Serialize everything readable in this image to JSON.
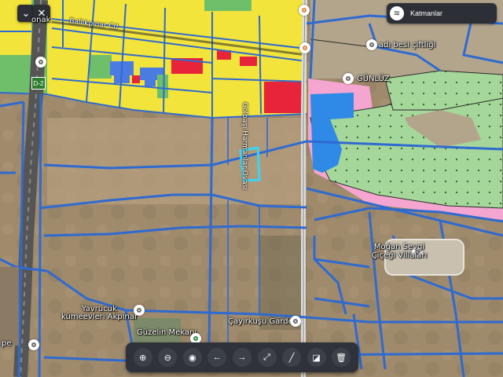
{
  "top_controls": {
    "collapse_glyph": "⌄",
    "close_glyph": "✕"
  },
  "layers": {
    "label": "Katmanlar",
    "icon": "layers-icon"
  },
  "place_labels": {
    "onak": "onak",
    "balikpinar": "Ballıkpınar Cd",
    "besi": "adı besi çiftliği",
    "gunluz": "GÜNLÜZ",
    "harmanlar": "Gölbaşı Harmanlar Ovası",
    "mogan": "Moğan Sevgi Çiçeği Villaları",
    "yavrucuk_1": "Yavrucuk",
    "yavrucuk_2": "kümeevleri Akpınar",
    "cayirkusu": "Çayırkuşu Garden",
    "guzelin": "Güzelin Mekanı",
    "pe": "pe",
    "highway": "D-2"
  },
  "toolbar": [
    {
      "name": "zoom-in-button",
      "icon": "zoom-in-icon",
      "glyph": "⊕"
    },
    {
      "name": "zoom-out-button",
      "icon": "zoom-out-icon",
      "glyph": "⊖"
    },
    {
      "name": "locate-button",
      "icon": "locate-icon",
      "glyph": "◉"
    },
    {
      "name": "back-button",
      "icon": "arrow-left-icon",
      "glyph": "←"
    },
    {
      "name": "forward-button",
      "icon": "arrow-right-icon",
      "glyph": "→"
    },
    {
      "name": "fullscreen-button",
      "icon": "fullscreen-icon",
      "glyph": "⤢"
    },
    {
      "name": "measure-button",
      "icon": "ruler-icon",
      "glyph": "╱"
    },
    {
      "name": "area-button",
      "icon": "area-icon",
      "glyph": "◪"
    },
    {
      "name": "delete-button",
      "icon": "trash-icon",
      "glyph": "🗑"
    }
  ],
  "colors": {
    "parcel_border": "#2f6ad0",
    "selected": "#39d5f5",
    "residential": "#f2e43a",
    "commercial": "#e8243a",
    "public": "#4b7be0",
    "green": "#a6d79a",
    "pink": "#f5a6d0"
  }
}
